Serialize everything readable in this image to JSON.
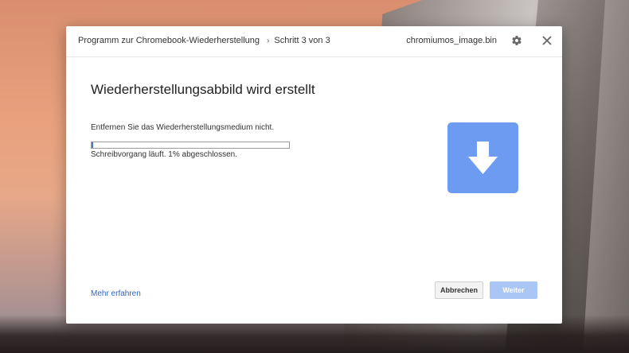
{
  "header": {
    "app_title": "Programm zur Chromebook-Wiederherstellung",
    "step": "Schritt 3 von 3",
    "filename": "chromiumos_image.bin",
    "settings_icon": "gear-icon",
    "close_icon": "close-icon"
  },
  "main": {
    "title": "Wiederherstellungsabbild wird erstellt",
    "notice": "Entfernen Sie das Wiederherstellungsmedium nicht.",
    "progress_percent": 1,
    "status": "Schreibvorgang läuft. 1% abgeschlossen.",
    "hero_icon": "download-arrow-icon",
    "hero_color": "#6d9bf1"
  },
  "footer": {
    "learn_more": "Mehr erfahren",
    "cancel_label": "Abbrechen",
    "next_label": "Weiter"
  },
  "colors": {
    "accent": "#6d9bf1",
    "link": "#2f63c4",
    "progress": "#4a78c9",
    "disabled_button": "#a9c6f5"
  }
}
